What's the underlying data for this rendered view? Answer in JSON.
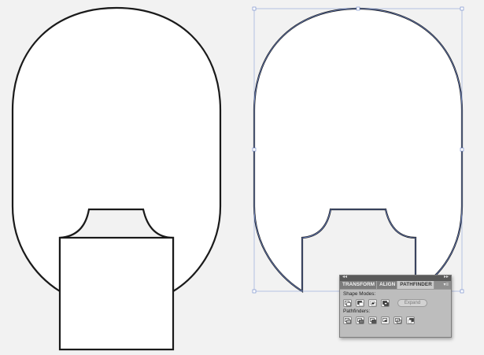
{
  "panel": {
    "tabs": [
      {
        "label": "TRANSFORM",
        "active": false
      },
      {
        "label": "ALIGN",
        "active": false
      },
      {
        "label": "PATHFINDER",
        "active": true
      }
    ],
    "shape_modes_label": "Shape Modes:",
    "pathfinders_label": "Pathfinders:",
    "expand_label": "Expand",
    "shape_mode_buttons": [
      "unite-icon",
      "minus-front-icon",
      "intersect-icon",
      "exclude-icon"
    ],
    "pathfinder_buttons": [
      "divide-icon",
      "trim-icon",
      "merge-icon",
      "crop-icon",
      "outline-icon",
      "minus-back-icon"
    ]
  },
  "colors": {
    "background": "#f2f2f2",
    "stroke": "#1a1a1a",
    "selection": "#6a84c8"
  }
}
